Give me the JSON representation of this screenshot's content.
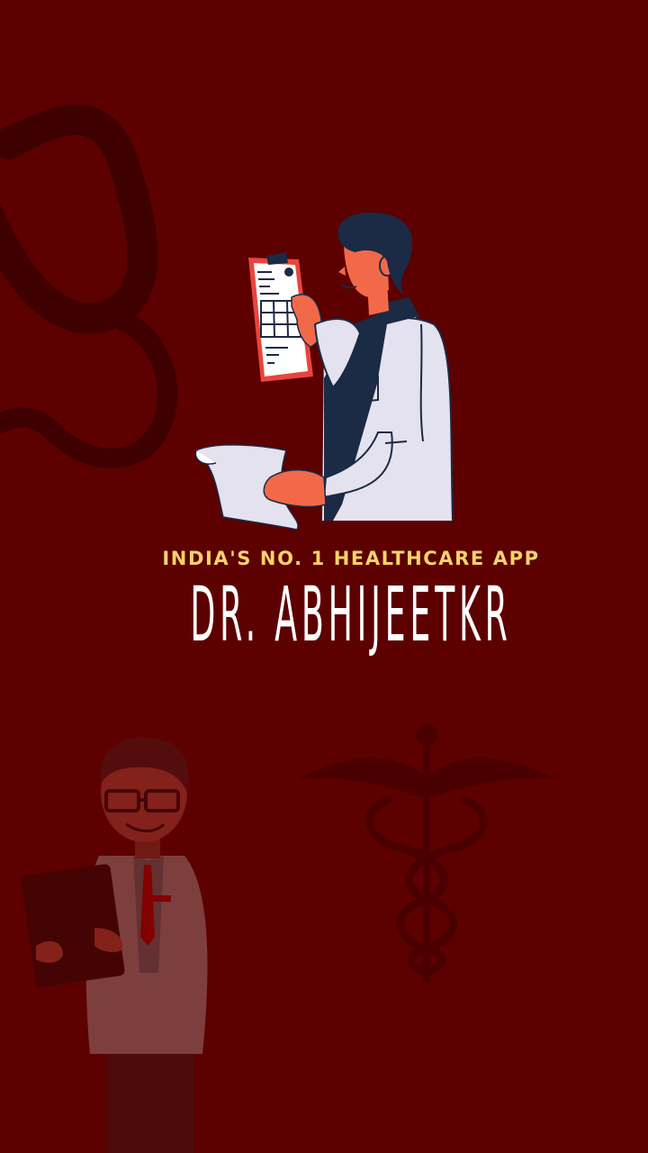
{
  "splash": {
    "tagline": "INDIA'S NO. 1 HEALTHCARE APP",
    "brand_name": "DR. ABHIJEETKR"
  },
  "colors": {
    "background": "#5c0000",
    "tagline": "#f6d36a",
    "brand": "#ffffff",
    "coat": "#e4e2ee",
    "skin": "#f2694a",
    "navy": "#1b2a45",
    "clipboard_frame": "#e8453c"
  },
  "icons": {
    "stethoscope": "stethoscope-icon",
    "caduceus": "caduceus-icon"
  }
}
